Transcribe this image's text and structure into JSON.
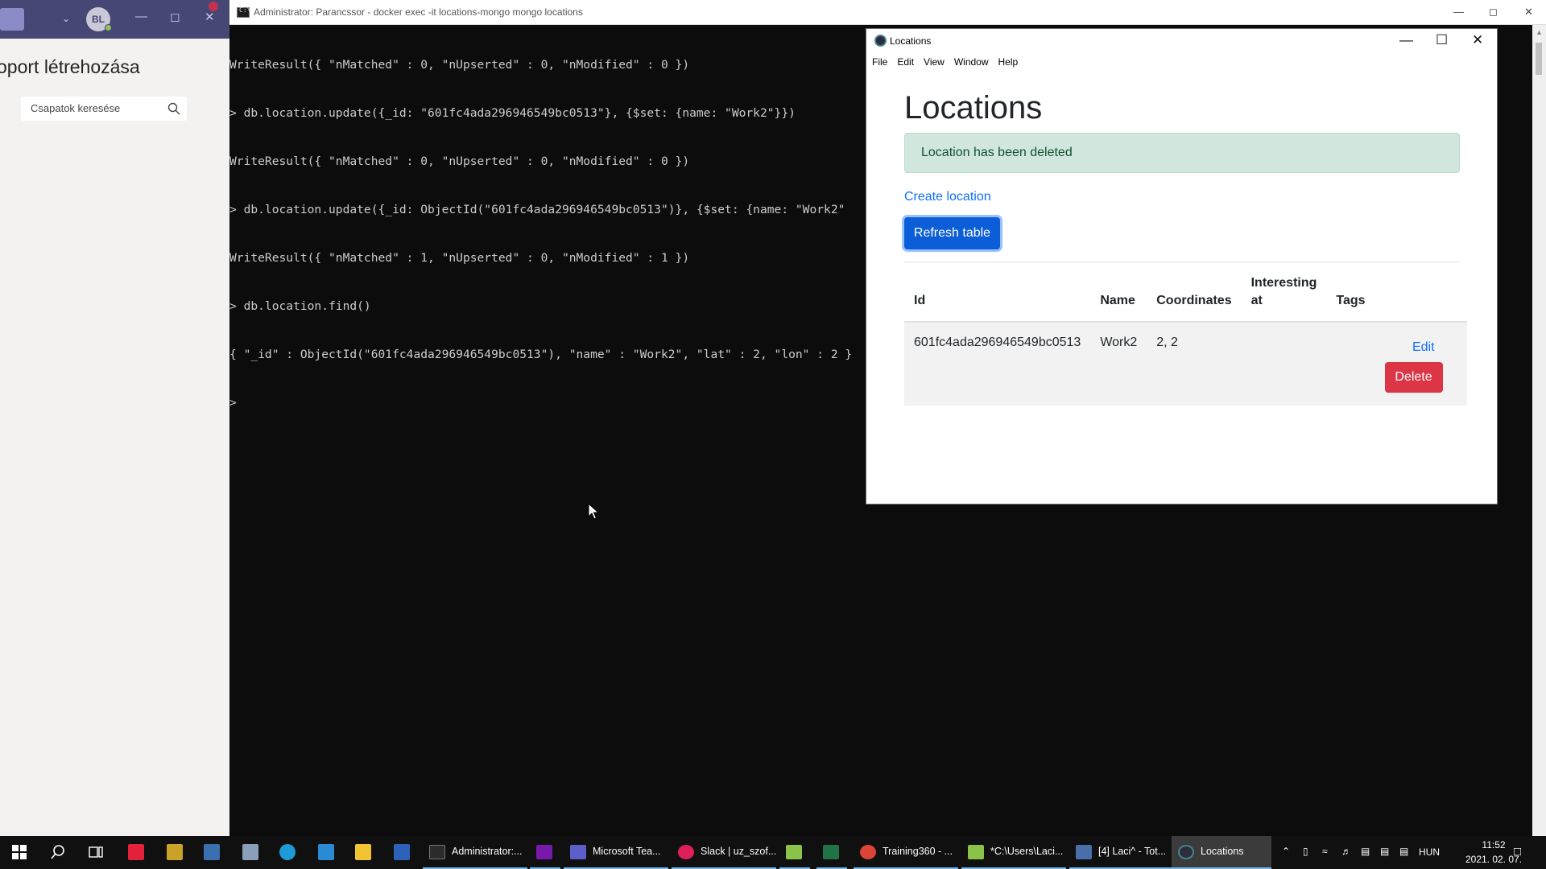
{
  "teams": {
    "avatar_initials": "BL",
    "heading": "oport létrehozása",
    "search_placeholder": "Csapatok keresése"
  },
  "console": {
    "title": "Administrator: Parancssor - docker  exec -it locations-mongo mongo locations",
    "lines": [
      "WriteResult({ \"nMatched\" : 0, \"nUpserted\" : 0, \"nModified\" : 0 })",
      "> db.location.update({_id: \"601fc4ada296946549bc0513\"}, {$set: {name: \"Work2\"}})",
      "WriteResult({ \"nMatched\" : 0, \"nUpserted\" : 0, \"nModified\" : 0 })",
      "> db.location.update({_id: ObjectId(\"601fc4ada296946549bc0513\")}, {$set: {name: \"Work2\"",
      "WriteResult({ \"nMatched\" : 1, \"nUpserted\" : 0, \"nModified\" : 1 })",
      "> db.location.find()",
      "{ \"_id\" : ObjectId(\"601fc4ada296946549bc0513\"), \"name\" : \"Work2\", \"lat\" : 2, \"lon\" : 2 }",
      ">"
    ]
  },
  "locations_window": {
    "title": "Locations",
    "menu": [
      "File",
      "Edit",
      "View",
      "Window",
      "Help"
    ],
    "heading": "Locations",
    "alert": "Location has been deleted",
    "create_link": "Create location",
    "refresh_button": "Refresh table",
    "table": {
      "headers": [
        "Id",
        "Name",
        "Coordinates",
        "Interesting at",
        "Tags"
      ],
      "rows": [
        {
          "id": "601fc4ada296946549bc0513",
          "name": "Work2",
          "coordinates": "2, 2",
          "interesting_at": "",
          "tags": "",
          "edit": "Edit",
          "delete": "Delete"
        }
      ]
    }
  },
  "taskbar": {
    "apps": [
      {
        "label": "Administrator:...",
        "icon": "console-icon",
        "color": "#2b2b2b"
      },
      {
        "label": "",
        "icon": "onenote-icon",
        "color": "#7719aa"
      },
      {
        "label": "Microsoft Tea...",
        "icon": "teams-icon",
        "color": "#5b5fc7"
      },
      {
        "label": "Slack | uz_szof...",
        "icon": "slack-icon",
        "color": "#e01e5a"
      },
      {
        "label": "",
        "icon": "notepadpp-icon",
        "color": "#8bc34a"
      },
      {
        "label": "",
        "icon": "excel-icon",
        "color": "#217346"
      },
      {
        "label": "Training360 - ...",
        "icon": "chrome-icon",
        "color": "#db4437"
      },
      {
        "label": "*C:\\Users\\Laci...",
        "icon": "notepad-icon",
        "color": "#8bc34a"
      },
      {
        "label": "[4] Laci^ - Tot...",
        "icon": "totalcmd-icon",
        "color": "#4a6ea9"
      },
      {
        "label": "Locations",
        "icon": "electron-icon",
        "color": "#47848f"
      }
    ],
    "language": "HUN",
    "time": "11:52",
    "date": "2021. 02. 07."
  }
}
